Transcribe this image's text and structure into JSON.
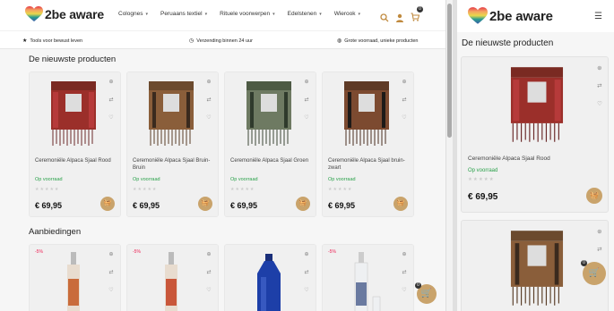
{
  "brand": {
    "name": "2be aware"
  },
  "nav": [
    {
      "label": "Colognes"
    },
    {
      "label": "Peruaans textiel"
    },
    {
      "label": "Rituele voorwerpen"
    },
    {
      "label": "Edelstenen"
    },
    {
      "label": "Wierook"
    }
  ],
  "header_icons": {
    "cart_count": "0"
  },
  "usp": {
    "left": "Tools voor bewust leven",
    "center": "Verzending binnen 24 uur",
    "right": "Grote voorraad, unieke producten"
  },
  "sections": {
    "newest": "De nieuwste producten",
    "offers": "Aanbiedingen"
  },
  "products": [
    {
      "name": "Ceremoniële Alpaca Sjaal Rood",
      "stock": "Op voorraad",
      "stars": "★★★★★",
      "price": "€ 69,95"
    },
    {
      "name": "Ceremoniële Alpaca Sjaal Bruin-Bruin",
      "stock": "Op voorraad",
      "stars": "★★★★★",
      "price": "€ 69,95"
    },
    {
      "name": "Ceremoniële Alpaca Sjaal Groen",
      "stock": "Op voorraad",
      "stars": "★★★★★",
      "price": "€ 69,95"
    },
    {
      "name": "Ceremoniële Alpaca Sjaal bruin-zwart",
      "stock": "Op voorraad",
      "stars": "★★★★★",
      "price": "€ 69,95"
    }
  ],
  "offers": [
    {
      "tag": "-5%"
    },
    {
      "tag": "-5%"
    },
    {
      "tag": ""
    },
    {
      "tag": "-5%"
    }
  ],
  "floating_cart_count": "0",
  "mobile": {
    "section_title": "De nieuwste producten",
    "product": {
      "name": "Ceremoniële Alpaca Sjaal Rood",
      "stock": "Op voorraad",
      "stars": "★★★★★",
      "price": "€ 69,95"
    },
    "floating_cart_count": "0"
  },
  "colors": {
    "accent": "#c9a36b",
    "stock": "#2aa14a",
    "icon": "#c08a3e"
  }
}
